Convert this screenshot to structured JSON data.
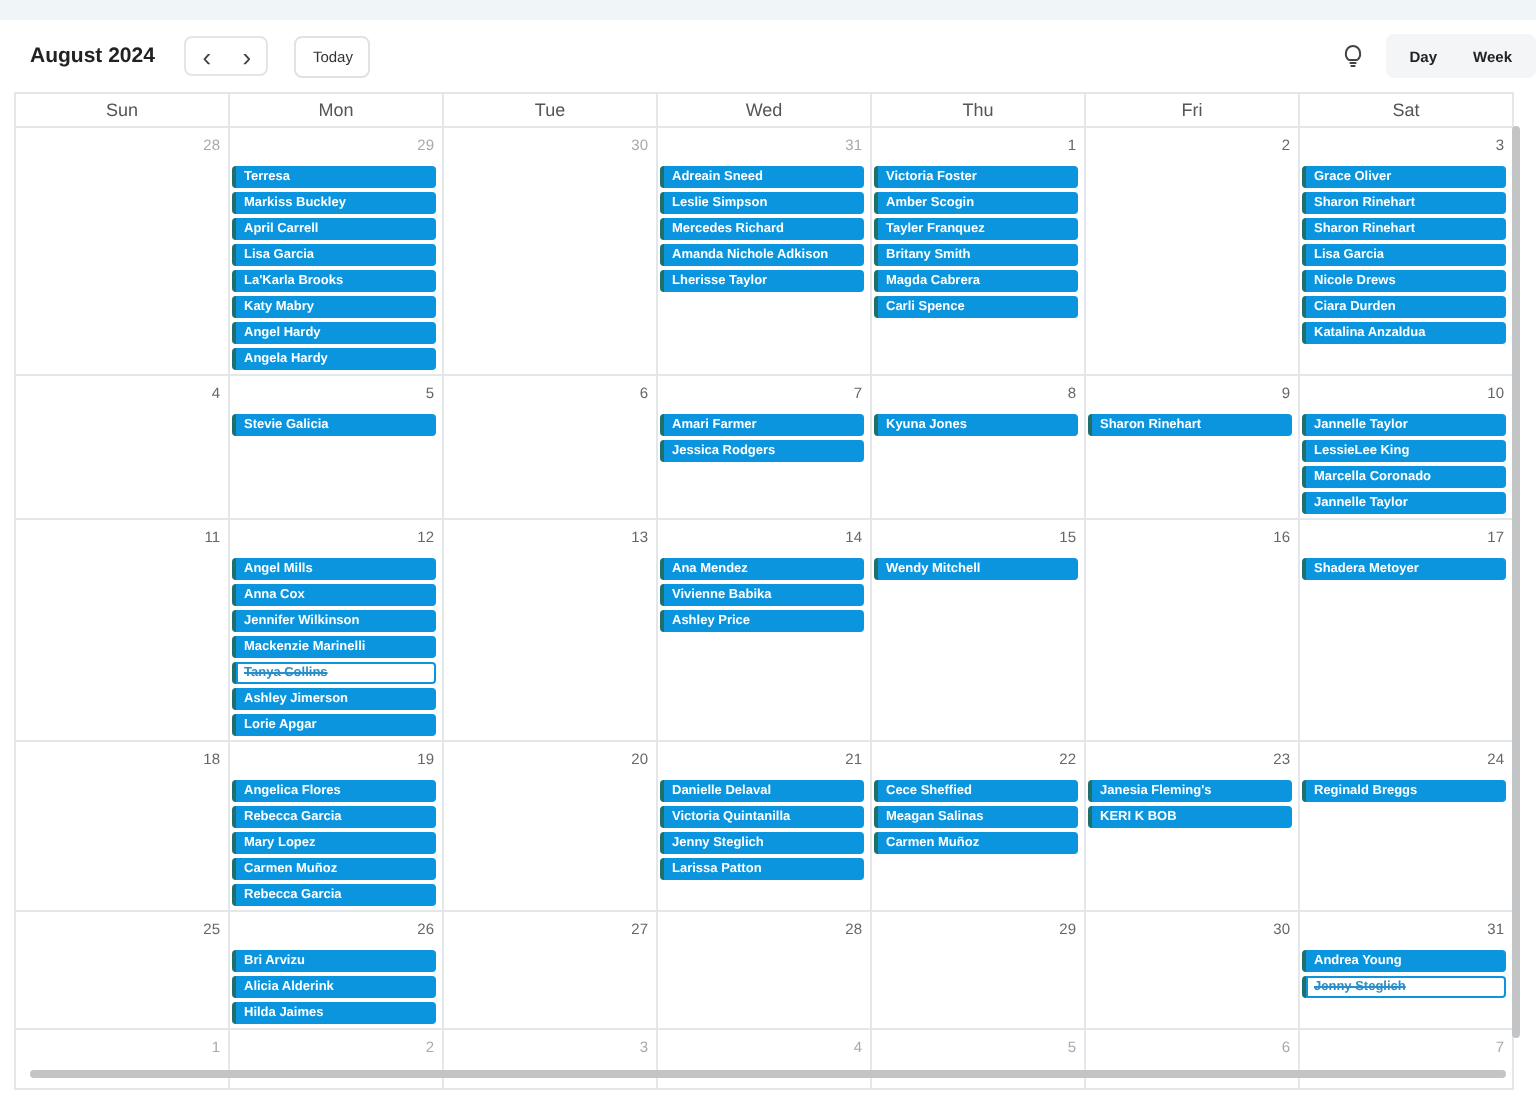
{
  "toolbar": {
    "title": "August 2024",
    "prev": "‹",
    "next": "›",
    "today": "Today",
    "views": [
      "Day",
      "Week"
    ]
  },
  "weekdays": [
    "Sun",
    "Mon",
    "Tue",
    "Wed",
    "Thu",
    "Fri",
    "Sat"
  ],
  "weeks": [
    {
      "days": [
        {
          "date": "28",
          "outside": true
        },
        {
          "date": "29",
          "outside": true,
          "events": [
            {
              "name": "Terresa",
              "cancelled": false
            },
            {
              "name": "Markiss Buckley",
              "cancelled": false
            },
            {
              "name": "April Carrell",
              "cancelled": false
            },
            {
              "name": "Lisa Garcia",
              "cancelled": false
            },
            {
              "name": "La'Karla Brooks",
              "cancelled": false
            },
            {
              "name": "Katy Mabry",
              "cancelled": false
            },
            {
              "name": "Angel Hardy",
              "cancelled": false
            },
            {
              "name": "Angela Hardy",
              "cancelled": false
            }
          ]
        },
        {
          "date": "30",
          "outside": true
        },
        {
          "date": "31",
          "outside": true,
          "events": [
            {
              "name": "Adreain Sneed",
              "cancelled": false
            },
            {
              "name": "Leslie Simpson",
              "cancelled": false
            },
            {
              "name": "Mercedes Richard",
              "cancelled": false
            },
            {
              "name": "Amanda Nichole Adkison",
              "cancelled": false
            },
            {
              "name": "Lherisse Taylor",
              "cancelled": false
            }
          ]
        },
        {
          "date": "1",
          "outside": false,
          "events": [
            {
              "name": "Victoria Foster",
              "cancelled": false
            },
            {
              "name": "Amber Scogin",
              "cancelled": false
            },
            {
              "name": "Tayler Franquez",
              "cancelled": false
            },
            {
              "name": "Britany Smith",
              "cancelled": false
            },
            {
              "name": "Magda Cabrera",
              "cancelled": false
            },
            {
              "name": "Carli Spence",
              "cancelled": false
            }
          ]
        },
        {
          "date": "2",
          "outside": false
        },
        {
          "date": "3",
          "outside": false,
          "events": [
            {
              "name": "Grace Oliver",
              "cancelled": false
            },
            {
              "name": "Sharon Rinehart",
              "cancelled": false
            },
            {
              "name": "Sharon Rinehart",
              "cancelled": false
            },
            {
              "name": "Lisa Garcia",
              "cancelled": false
            },
            {
              "name": "Nicole Drews",
              "cancelled": false
            },
            {
              "name": "Ciara Durden",
              "cancelled": false
            },
            {
              "name": "Katalina Anzaldua",
              "cancelled": false
            }
          ]
        }
      ]
    },
    {
      "days": [
        {
          "date": "4",
          "outside": false
        },
        {
          "date": "5",
          "outside": false,
          "events": [
            {
              "name": "Stevie Galicia",
              "cancelled": false
            }
          ]
        },
        {
          "date": "6",
          "outside": false
        },
        {
          "date": "7",
          "outside": false,
          "events": [
            {
              "name": "Amari Farmer",
              "cancelled": false
            },
            {
              "name": "Jessica Rodgers",
              "cancelled": false
            }
          ]
        },
        {
          "date": "8",
          "outside": false,
          "events": [
            {
              "name": "Kyuna Jones",
              "cancelled": false
            }
          ]
        },
        {
          "date": "9",
          "outside": false,
          "events": [
            {
              "name": "Sharon Rinehart",
              "cancelled": false
            }
          ]
        },
        {
          "date": "10",
          "outside": false,
          "events": [
            {
              "name": "Jannelle Taylor",
              "cancelled": false
            },
            {
              "name": "LessieLee King",
              "cancelled": false
            },
            {
              "name": "Marcella Coronado",
              "cancelled": false
            },
            {
              "name": "Jannelle Taylor",
              "cancelled": false
            }
          ]
        }
      ]
    },
    {
      "days": [
        {
          "date": "11",
          "outside": false
        },
        {
          "date": "12",
          "outside": false,
          "events": [
            {
              "name": "Angel Mills",
              "cancelled": false
            },
            {
              "name": "Anna Cox",
              "cancelled": false
            },
            {
              "name": "Jennifer Wilkinson",
              "cancelled": false
            },
            {
              "name": "Mackenzie Marinelli",
              "cancelled": false
            },
            {
              "name": "Tanya Collins",
              "cancelled": true
            },
            {
              "name": "Ashley Jimerson",
              "cancelled": false
            },
            {
              "name": "Lorie Apgar",
              "cancelled": false
            }
          ]
        },
        {
          "date": "13",
          "outside": false
        },
        {
          "date": "14",
          "outside": false,
          "events": [
            {
              "name": "Ana Mendez",
              "cancelled": false
            },
            {
              "name": "Vivienne Babika",
              "cancelled": false
            },
            {
              "name": "Ashley Price",
              "cancelled": false
            }
          ]
        },
        {
          "date": "15",
          "outside": false,
          "events": [
            {
              "name": "Wendy Mitchell",
              "cancelled": false
            }
          ]
        },
        {
          "date": "16",
          "outside": false
        },
        {
          "date": "17",
          "outside": false,
          "events": [
            {
              "name": "Shadera Metoyer",
              "cancelled": false
            }
          ]
        }
      ]
    },
    {
      "days": [
        {
          "date": "18",
          "outside": false
        },
        {
          "date": "19",
          "outside": false,
          "events": [
            {
              "name": "Angelica Flores",
              "cancelled": false
            },
            {
              "name": "Rebecca Garcia",
              "cancelled": false
            },
            {
              "name": "Mary Lopez",
              "cancelled": false
            },
            {
              "name": "Carmen Muñoz",
              "cancelled": false
            },
            {
              "name": "Rebecca Garcia",
              "cancelled": false
            }
          ]
        },
        {
          "date": "20",
          "outside": false
        },
        {
          "date": "21",
          "outside": false,
          "events": [
            {
              "name": "Danielle Delaval",
              "cancelled": false
            },
            {
              "name": "Victoria Quintanilla",
              "cancelled": false
            },
            {
              "name": "Jenny Steglich",
              "cancelled": false
            },
            {
              "name": "Larissa Patton",
              "cancelled": false
            }
          ]
        },
        {
          "date": "22",
          "outside": false,
          "events": [
            {
              "name": "Cece Sheffied",
              "cancelled": false
            },
            {
              "name": "Meagan Salinas",
              "cancelled": false
            },
            {
              "name": "Carmen Muñoz",
              "cancelled": false
            }
          ]
        },
        {
          "date": "23",
          "outside": false,
          "events": [
            {
              "name": "Janesia Fleming's",
              "cancelled": false
            },
            {
              "name": "KERI K BOB",
              "cancelled": false
            }
          ]
        },
        {
          "date": "24",
          "outside": false,
          "events": [
            {
              "name": "Reginald Breggs",
              "cancelled": false
            }
          ]
        }
      ]
    },
    {
      "days": [
        {
          "date": "25",
          "outside": false
        },
        {
          "date": "26",
          "outside": false,
          "events": [
            {
              "name": "Bri Arvizu",
              "cancelled": false
            },
            {
              "name": "Alicia Alderink",
              "cancelled": false
            },
            {
              "name": "Hilda Jaimes",
              "cancelled": false
            }
          ]
        },
        {
          "date": "27",
          "outside": false
        },
        {
          "date": "28",
          "outside": false
        },
        {
          "date": "29",
          "outside": false
        },
        {
          "date": "30",
          "outside": false
        },
        {
          "date": "31",
          "outside": false,
          "events": [
            {
              "name": "Andrea Young",
              "cancelled": false
            },
            {
              "name": "Jenny Steglich",
              "cancelled": true
            }
          ]
        }
      ]
    },
    {
      "days": [
        {
          "date": "1",
          "outside": true
        },
        {
          "date": "2",
          "outside": true
        },
        {
          "date": "3",
          "outside": true
        },
        {
          "date": "4",
          "outside": true
        },
        {
          "date": "5",
          "outside": true
        },
        {
          "date": "6",
          "outside": true
        },
        {
          "date": "7",
          "outside": true
        }
      ]
    }
  ]
}
